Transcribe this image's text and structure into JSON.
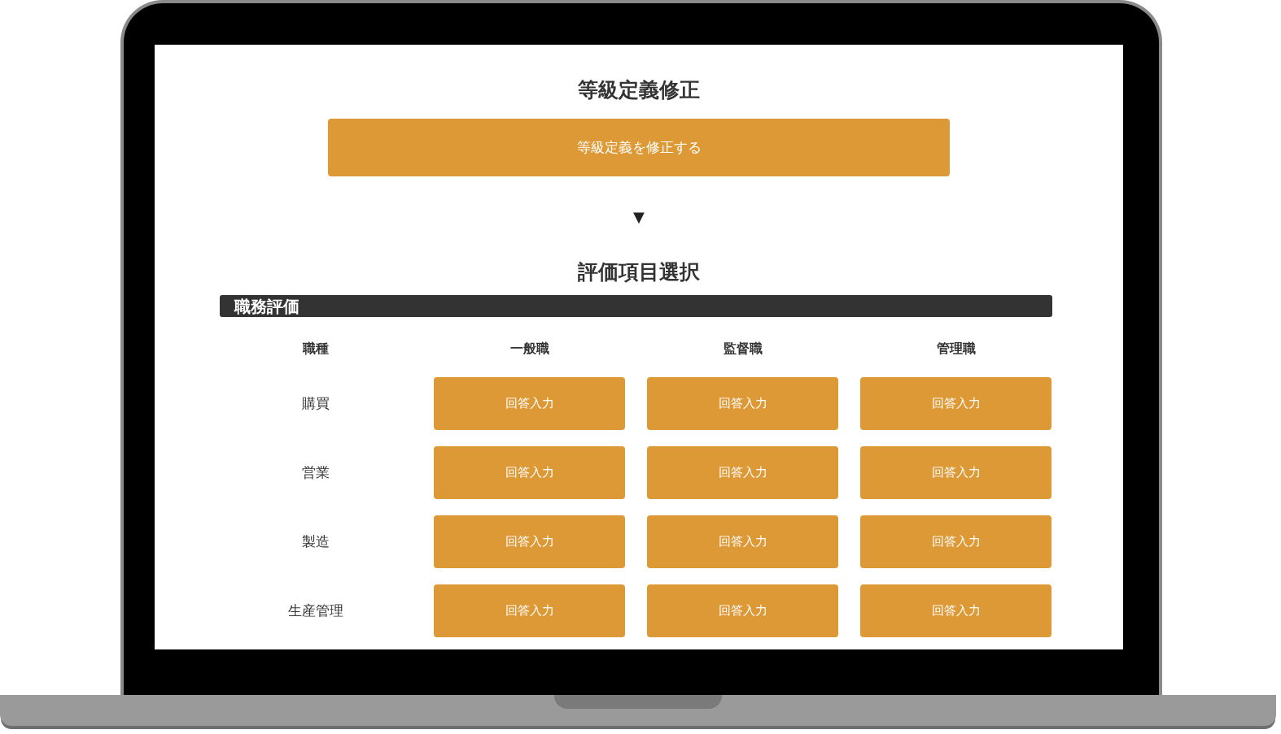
{
  "grade_section": {
    "title": "等級定義修正",
    "button": "等級定義を修正する"
  },
  "arrow": "▼",
  "evaluation_section": {
    "title": "評価項目選択",
    "category": "職務評価",
    "columns": [
      "職種",
      "一般職",
      "監督職",
      "管理職"
    ],
    "rows": [
      {
        "job": "購買",
        "buttons": [
          "回答入力",
          "回答入力",
          "回答入力"
        ]
      },
      {
        "job": "営業",
        "buttons": [
          "回答入力",
          "回答入力",
          "回答入力"
        ]
      },
      {
        "job": "製造",
        "buttons": [
          "回答入力",
          "回答入力",
          "回答入力"
        ]
      },
      {
        "job": "生産管理",
        "buttons": [
          "回答入力",
          "回答入力",
          "回答入力"
        ]
      }
    ]
  }
}
